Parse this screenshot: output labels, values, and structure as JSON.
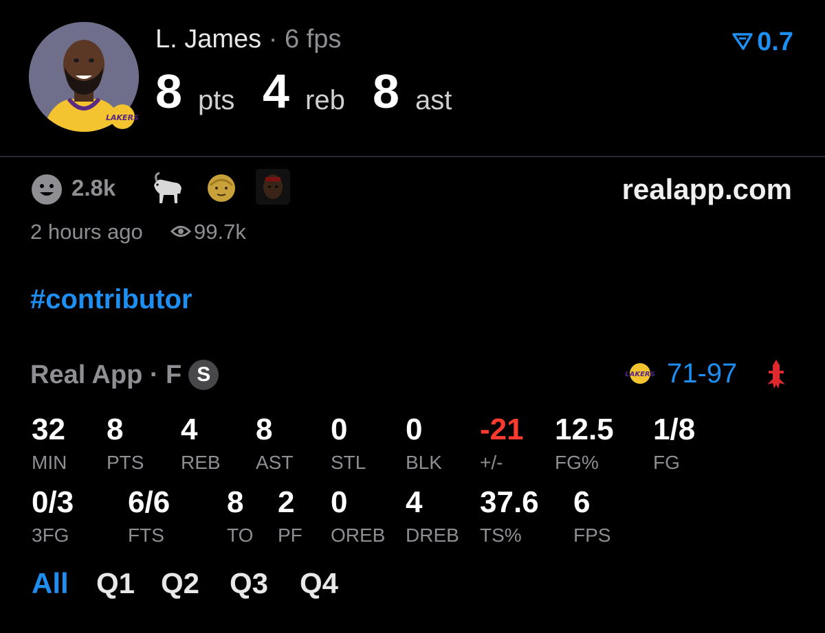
{
  "player": {
    "name": "L. James",
    "separator": "·",
    "fps": "6 fps",
    "pts_value": "8",
    "pts_unit": "pts",
    "reb_value": "4",
    "reb_unit": "reb",
    "ast_value": "8",
    "ast_unit": "ast"
  },
  "rating": {
    "icon": "real-rating-icon",
    "value": "0.7",
    "color": "#1e8ff0"
  },
  "reactions": {
    "count": "2.8k",
    "icons": [
      "smile-icon",
      "goat-emoji-icon",
      "old-man-emoji-icon",
      "player-face-icon"
    ]
  },
  "brand": "realapp.com",
  "meta": {
    "time": "2 hours ago",
    "views": "99.7k"
  },
  "hashtag": "#contributor",
  "game": {
    "source": "Real App · F",
    "badge": "S",
    "score": "71-97",
    "home_team_icon": "lakers-logo-icon",
    "away_team_icon": "rockets-logo-icon"
  },
  "stats_row1": [
    {
      "value": "32",
      "label": "MIN"
    },
    {
      "value": "8",
      "label": "PTS"
    },
    {
      "value": "4",
      "label": "REB"
    },
    {
      "value": "8",
      "label": "AST"
    },
    {
      "value": "0",
      "label": "STL"
    },
    {
      "value": "0",
      "label": "BLK"
    },
    {
      "value": "-21",
      "label": "+/-"
    },
    {
      "value": "12.5",
      "label": "FG%"
    },
    {
      "value": "1/8",
      "label": "FG"
    }
  ],
  "stats_row2": [
    {
      "value": "0/3",
      "label": "3FG"
    },
    {
      "value": "6/6",
      "label": "FTS"
    },
    {
      "value": "8",
      "label": "TO"
    },
    {
      "value": "2",
      "label": "PF"
    },
    {
      "value": "0",
      "label": "OREB"
    },
    {
      "value": "4",
      "label": "DREB"
    },
    {
      "value": "37.6",
      "label": "TS%"
    },
    {
      "value": "6",
      "label": "FPS"
    }
  ],
  "tabs": [
    "All",
    "Q1",
    "Q2",
    "Q3",
    "Q4"
  ],
  "colors": {
    "accent": "#1e8ff0",
    "negative": "#ff3b30",
    "muted": "#8e8e93"
  }
}
